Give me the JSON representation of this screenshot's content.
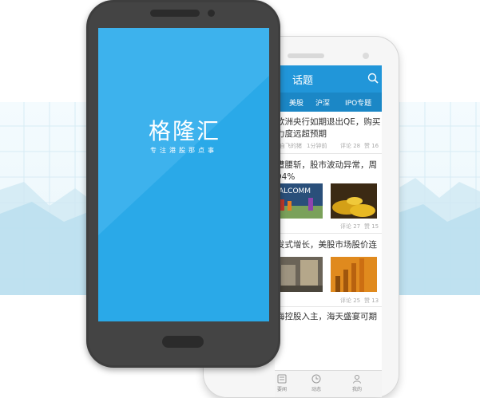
{
  "splash": {
    "logo_text": "格隆汇",
    "slogan": "专注港股那点事"
  },
  "app": {
    "header_title": "话题",
    "tabs": [
      "美股",
      "沪深",
      "IPO专题"
    ],
    "articles": [
      {
        "lines": [
          "欧洲央行如期退出QE，购买",
          "力度远超预期"
        ],
        "meta_source": "自飞的猪",
        "meta_time": "1分钟前",
        "comments": "评论 28",
        "likes": "赞 16"
      },
      {
        "lines": [
          "遭腰斩，股市波动异常，周",
          "94%"
        ],
        "meta_source": "",
        "meta_time": "",
        "comments": "评论 27",
        "likes": "赞 15"
      },
      {
        "lines": [
          "发式增长，美股市场股价连"
        ],
        "meta_source": "",
        "meta_time": "",
        "comments": "评论 25",
        "likes": "赞 13"
      },
      {
        "lines": [
          "海控股入主，海天盛宴可期"
        ],
        "meta_source": "",
        "meta_time": "",
        "comments": "",
        "likes": ""
      }
    ],
    "thumb_text": "ALCOMM",
    "nav": [
      "要闻",
      "动态",
      "我的"
    ]
  },
  "colors": {
    "header_blue": "#2196d9",
    "tab_blue": "#1b87c6",
    "splash_blue": "#2aa9e8",
    "phone_dark": "#3e3e3e"
  },
  "icons": {
    "search": "search-icon",
    "nav": [
      "news-icon",
      "clock-icon",
      "person-icon"
    ]
  }
}
